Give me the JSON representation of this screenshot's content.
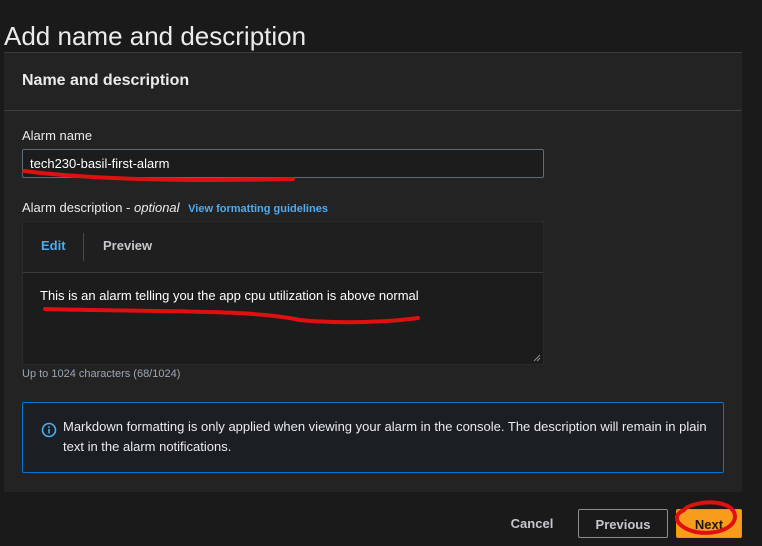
{
  "page": {
    "title": "Add name and description"
  },
  "section": {
    "title": "Name and description"
  },
  "alarm_name": {
    "label": "Alarm name",
    "value": "tech230-basil-first-alarm"
  },
  "alarm_description": {
    "label": "Alarm description -",
    "optional": "optional",
    "guidelines_link": "View formatting guidelines",
    "tab_edit": "Edit",
    "tab_preview": "Preview",
    "value": "This is an alarm telling you the app cpu utilization is above normal",
    "char_count": "Up to 1024 characters (68/1024)"
  },
  "info": {
    "text": "Markdown formatting is only applied when viewing your alarm in the console. The description will remain in plain text in the alarm notifications."
  },
  "footer": {
    "cancel_label": "Cancel",
    "previous_label": "Previous",
    "next_label": "Next"
  },
  "colors": {
    "accent_blue": "#4dabf0",
    "primary_orange": "#f89c1c",
    "annotation_red": "#e01010"
  }
}
